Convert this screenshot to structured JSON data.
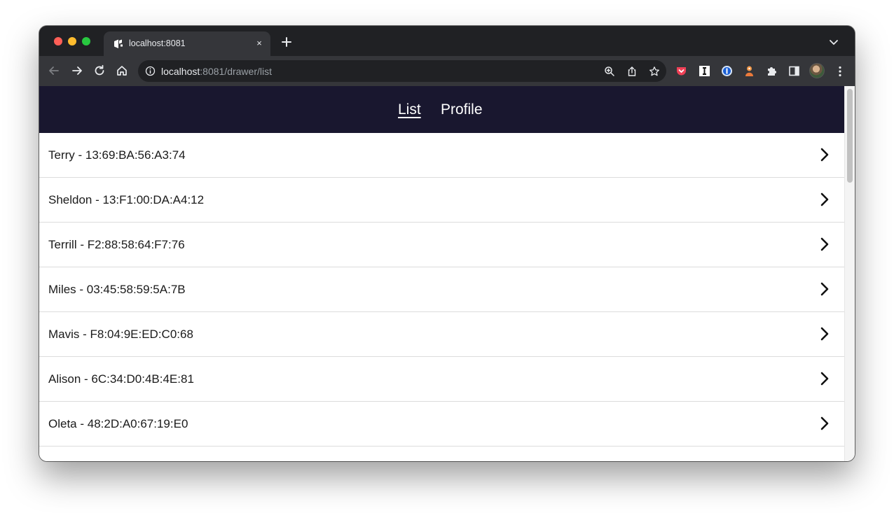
{
  "browser": {
    "tab_title": "localhost:8081",
    "tab_close": "×",
    "url_host": "localhost",
    "url_path": ":8081/drawer/list"
  },
  "app": {
    "nav": {
      "list_label": "List",
      "profile_label": "Profile"
    },
    "items": [
      "Terry - 13:69:BA:56:A3:74",
      "Sheldon - 13:F1:00:DA:A4:12",
      "Terrill - F2:88:58:64:F7:76",
      "Miles - 03:45:58:59:5A:7B",
      "Mavis - F8:04:9E:ED:C0:68",
      "Alison - 6C:34:D0:4B:4E:81",
      "Oleta - 48:2D:A0:67:19:E0",
      ""
    ]
  },
  "colors": {
    "header_bg": "#19172f",
    "browser_chrome": "#202124",
    "toolbar": "#35363a"
  }
}
